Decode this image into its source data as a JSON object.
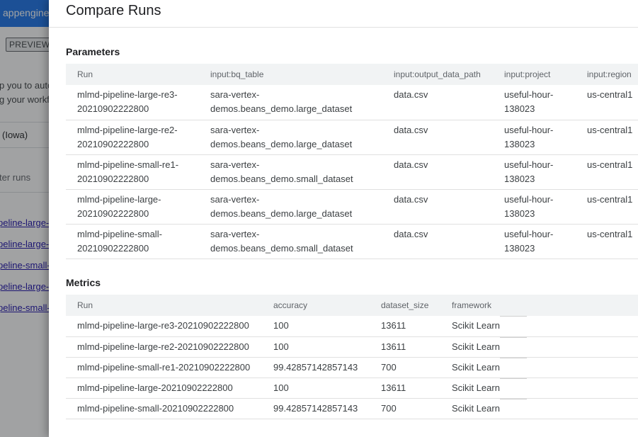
{
  "background": {
    "header_title": "appengine",
    "preview_badge": "PREVIEW",
    "text_line_1": "p you to auto",
    "text_line_2": "g your workfl",
    "region_label": "(Iowa)",
    "filter_label": "ter runs",
    "links": [
      "peline-large-",
      "peline-large-",
      "peline-small-",
      "peline-large-",
      "peline-small-"
    ]
  },
  "panel": {
    "title": "Compare Runs",
    "parameters": {
      "title": "Parameters",
      "columns": [
        "Run",
        "input:bq_table",
        "input:output_data_path",
        "input:project",
        "input:region"
      ],
      "rows": [
        [
          "mlmd-pipeline-large-re3-20210902222800",
          "sara-vertex-demos.beans_demo.large_dataset",
          "data.csv",
          "useful-hour-138023",
          "us-central1"
        ],
        [
          "mlmd-pipeline-large-re2-20210902222800",
          "sara-vertex-demos.beans_demo.large_dataset",
          "data.csv",
          "useful-hour-138023",
          "us-central1"
        ],
        [
          "mlmd-pipeline-small-re1-20210902222800",
          "sara-vertex-demos.beans_demo.small_dataset",
          "data.csv",
          "useful-hour-138023",
          "us-central1"
        ],
        [
          "mlmd-pipeline-large-20210902222800",
          "sara-vertex-demos.beans_demo.large_dataset",
          "data.csv",
          "useful-hour-138023",
          "us-central1"
        ],
        [
          "mlmd-pipeline-small-20210902222800",
          "sara-vertex-demos.beans_demo.small_dataset",
          "data.csv",
          "useful-hour-138023",
          "us-central1"
        ]
      ]
    },
    "metrics": {
      "title": "Metrics",
      "columns": [
        "Run",
        "accuracy",
        "dataset_size",
        "framework",
        ""
      ],
      "rows": [
        [
          "mlmd-pipeline-large-re3-20210902222800",
          "100",
          "13611",
          "Scikit Learn"
        ],
        [
          "mlmd-pipeline-large-re2-20210902222800",
          "100",
          "13611",
          "Scikit Learn"
        ],
        [
          "mlmd-pipeline-small-re1-20210902222800",
          "99.42857142857143",
          "700",
          "Scikit Learn"
        ],
        [
          "mlmd-pipeline-large-20210902222800",
          "100",
          "13611",
          "Scikit Learn"
        ],
        [
          "mlmd-pipeline-small-20210902222800",
          "99.42857142857143",
          "700",
          "Scikit Learn"
        ]
      ]
    }
  }
}
